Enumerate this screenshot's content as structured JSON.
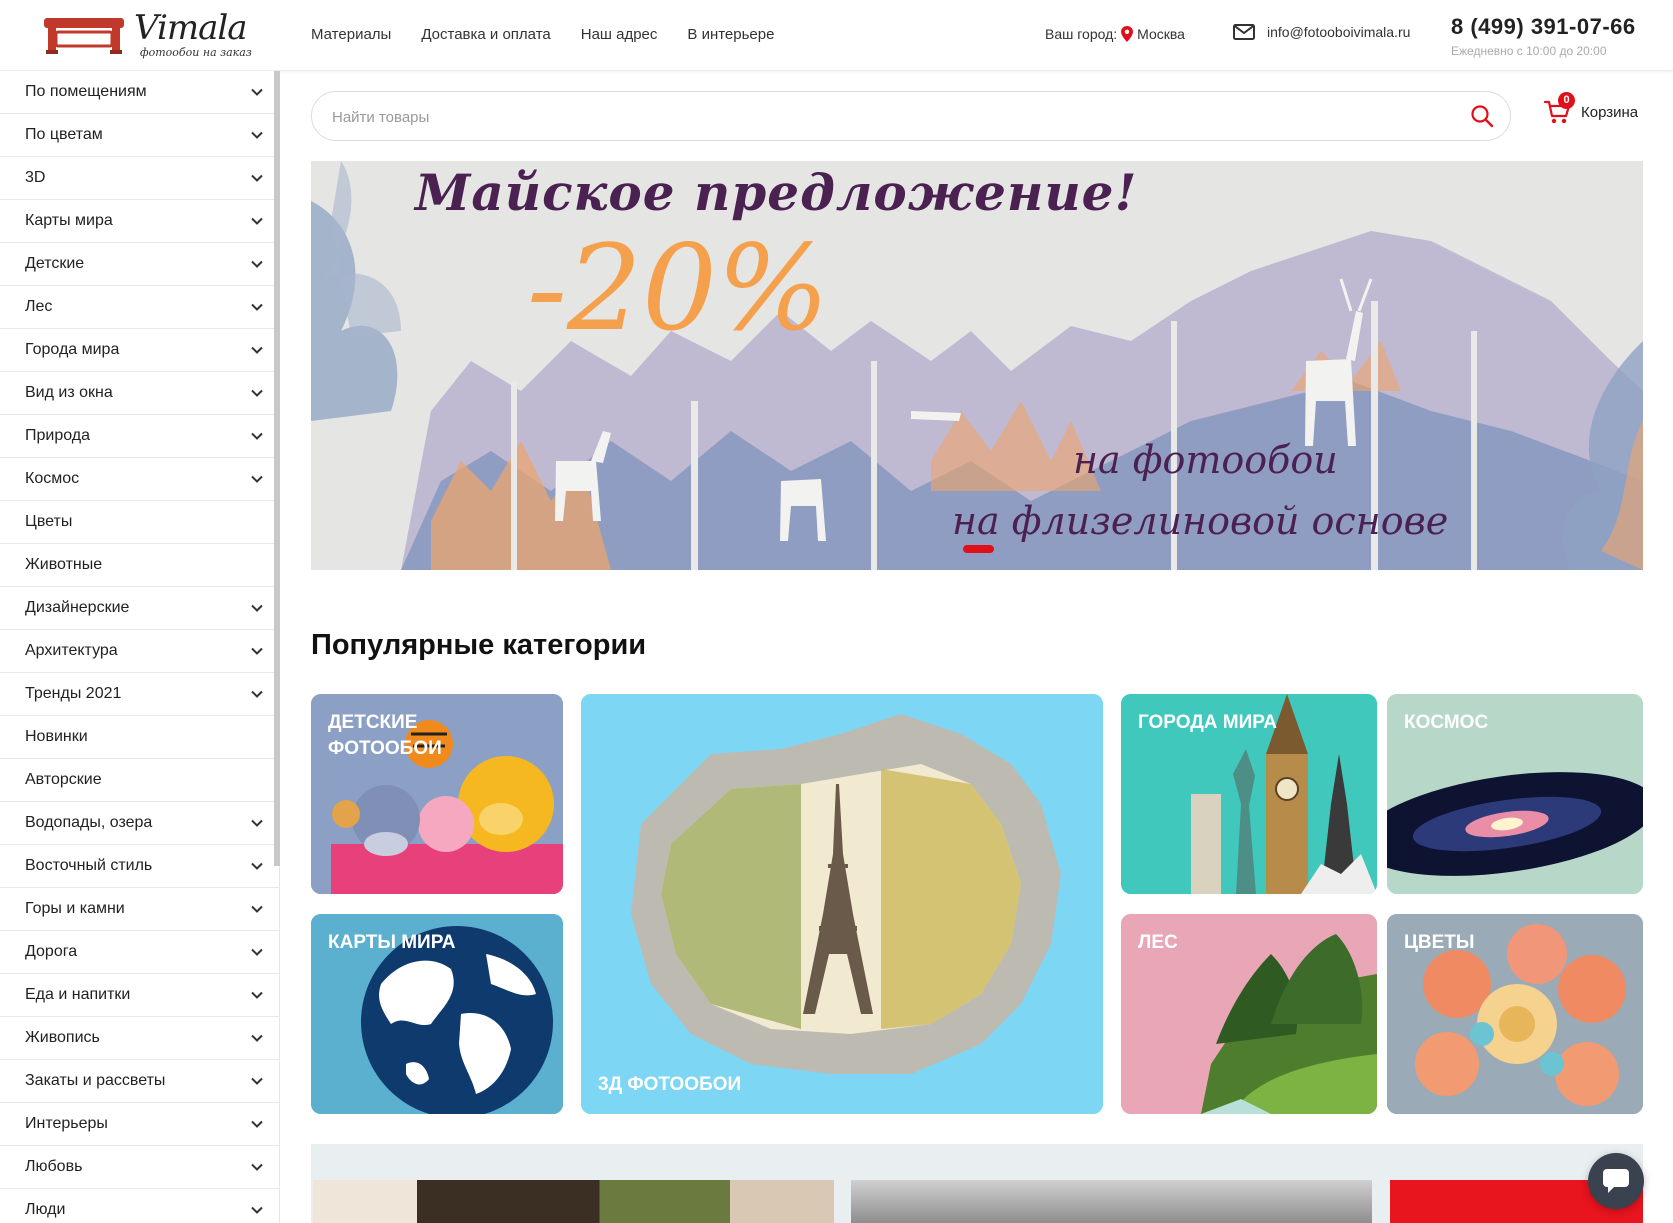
{
  "header": {
    "logo_text": "Vimala",
    "logo_subtitle": "фотообои на заказ",
    "nav": [
      "Материалы",
      "Доставка и оплата",
      "Наш адрес",
      "В интерьере"
    ],
    "city_label": "Ваш город:",
    "city_value": "Москва",
    "email": "info@fotooboivimala.ru",
    "phone": "8 (499) 391-07-66",
    "hours": "Ежедневно с 10:00 до 20:00"
  },
  "sidebar": {
    "items": [
      {
        "label": "По помещениям",
        "has_submenu": true
      },
      {
        "label": "По цветам",
        "has_submenu": true
      },
      {
        "label": "3D",
        "has_submenu": true
      },
      {
        "label": "Карты мира",
        "has_submenu": true
      },
      {
        "label": "Детские",
        "has_submenu": true
      },
      {
        "label": "Лес",
        "has_submenu": true
      },
      {
        "label": "Города мира",
        "has_submenu": true
      },
      {
        "label": "Вид из окна",
        "has_submenu": true
      },
      {
        "label": "Природа",
        "has_submenu": true
      },
      {
        "label": "Космос",
        "has_submenu": true
      },
      {
        "label": "Цветы",
        "has_submenu": false
      },
      {
        "label": "Животные",
        "has_submenu": false
      },
      {
        "label": "Дизайнерские",
        "has_submenu": true
      },
      {
        "label": "Архитектура",
        "has_submenu": true
      },
      {
        "label": "Тренды 2021",
        "has_submenu": true
      },
      {
        "label": "Новинки",
        "has_submenu": false
      },
      {
        "label": "Авторские",
        "has_submenu": false
      },
      {
        "label": "Водопады, озера",
        "has_submenu": true
      },
      {
        "label": "Восточный стиль",
        "has_submenu": true
      },
      {
        "label": "Горы и камни",
        "has_submenu": true
      },
      {
        "label": "Дорога",
        "has_submenu": true
      },
      {
        "label": "Еда и напитки",
        "has_submenu": true
      },
      {
        "label": "Живопись",
        "has_submenu": true
      },
      {
        "label": "Закаты и рассветы",
        "has_submenu": true
      },
      {
        "label": "Интерьеры",
        "has_submenu": true
      },
      {
        "label": "Любовь",
        "has_submenu": true
      },
      {
        "label": "Люди",
        "has_submenu": true
      }
    ]
  },
  "search": {
    "placeholder": "Найти товары",
    "value": ""
  },
  "cart": {
    "label": "Корзина",
    "count": "0"
  },
  "banner": {
    "title": "Майское предложение!",
    "discount": "-20%",
    "line1": "на фотообои",
    "line2": "на флизелиновой основе"
  },
  "categories": {
    "title": "Популярные категории",
    "tiles": {
      "kids": "Детские фотообои",
      "three_d": "3д фотообои",
      "cities": "Города мира",
      "space": "Космос",
      "maps": "Карты мира",
      "forest": "Лес",
      "flowers": "Цветы"
    }
  },
  "colors": {
    "accent_red": "#e0101a",
    "banner_purple": "#4a2150",
    "banner_orange": "#f5a04c"
  }
}
